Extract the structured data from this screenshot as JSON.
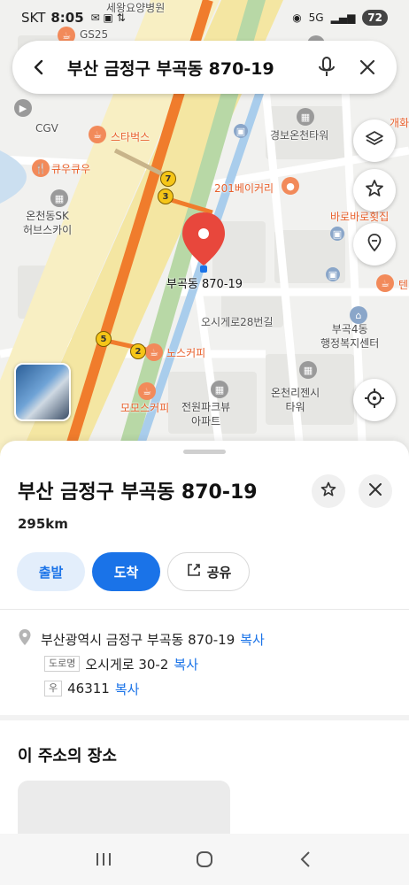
{
  "status_bar": {
    "carrier": "SKT",
    "time": "8:05",
    "battery": "72"
  },
  "search": {
    "query": "부산 금정구 부곡동 870-19"
  },
  "map": {
    "pin_label": "부곡동 870-19",
    "labels": {
      "hospital": "세왕요양병원",
      "gs25": "GS25",
      "cgv": "CGV",
      "starbucks": "스타벅스",
      "kyookyoo": "큐우큐우",
      "skhub": "온천동SK\n허브스카이",
      "gyeongbo": "경보온천타워",
      "bakery201": "201베이커리",
      "barobaro": "바로바로횟집",
      "gaehwa": "개화",
      "ten": "텐",
      "road28": "오시게로28번길",
      "bugok4": "부곡4동\n행정복지센터",
      "nose": "노스커피",
      "momo": "모모스커피",
      "jeonwon": "전원파크뷰\n아파트",
      "oncheon": "온천리젠시\n타워",
      "road_side": "오시게로"
    },
    "metro_badges": [
      "7",
      "3",
      "5",
      "2"
    ]
  },
  "sheet": {
    "title": "부산 금정구 부곡동 870-19",
    "distance": "295km",
    "start_label": "출발",
    "arrive_label": "도착",
    "share_label": "공유",
    "address": "부산광역시 금정구 부곡동 870-19",
    "copy_label": "복사",
    "road_tag": "도로명",
    "road_address": "오시게로 30-2",
    "postal_tag": "우",
    "postal_code": "46311",
    "section_title": "이 주소의 장소"
  },
  "colors": {
    "accent": "#1a73e8",
    "pin": "#e8473c",
    "road_orange": "#f07c2c",
    "road_yellow": "#f4e6a2"
  }
}
